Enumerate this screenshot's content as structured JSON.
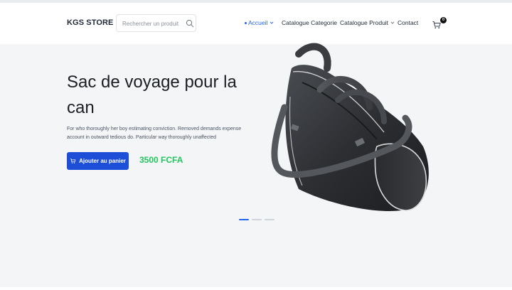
{
  "header": {
    "brand": "KGS STORE",
    "search_placeholder": "Rechercher un produit",
    "cart_count": "0"
  },
  "nav": {
    "items": [
      {
        "label": "Accueil",
        "active": true,
        "dropdown": true
      },
      {
        "label": "Catalogue Categorie",
        "active": false,
        "dropdown": false
      },
      {
        "label": "Catalogue Produit",
        "active": false,
        "dropdown": true
      },
      {
        "label": "Contact",
        "active": false,
        "dropdown": false
      }
    ]
  },
  "hero": {
    "title": "Sac de voyage pour la can",
    "description": "For who thoroughly her boy estimating conviction. Removed demands expense account in outward tedious do. Particular way thoroughly unaffected",
    "button_label": "Ajouter au panier",
    "price": "3500 FCFA"
  },
  "carousel": {
    "slides": 3,
    "active_index": 0
  },
  "colors": {
    "accent": "#2563eb",
    "button": "#1d4ed8",
    "price": "#22c55e",
    "hero_bg": "#f4f5f7"
  },
  "icons": {
    "search": "search-icon",
    "cart": "cart-icon",
    "chevron": "chevron-down-icon"
  }
}
